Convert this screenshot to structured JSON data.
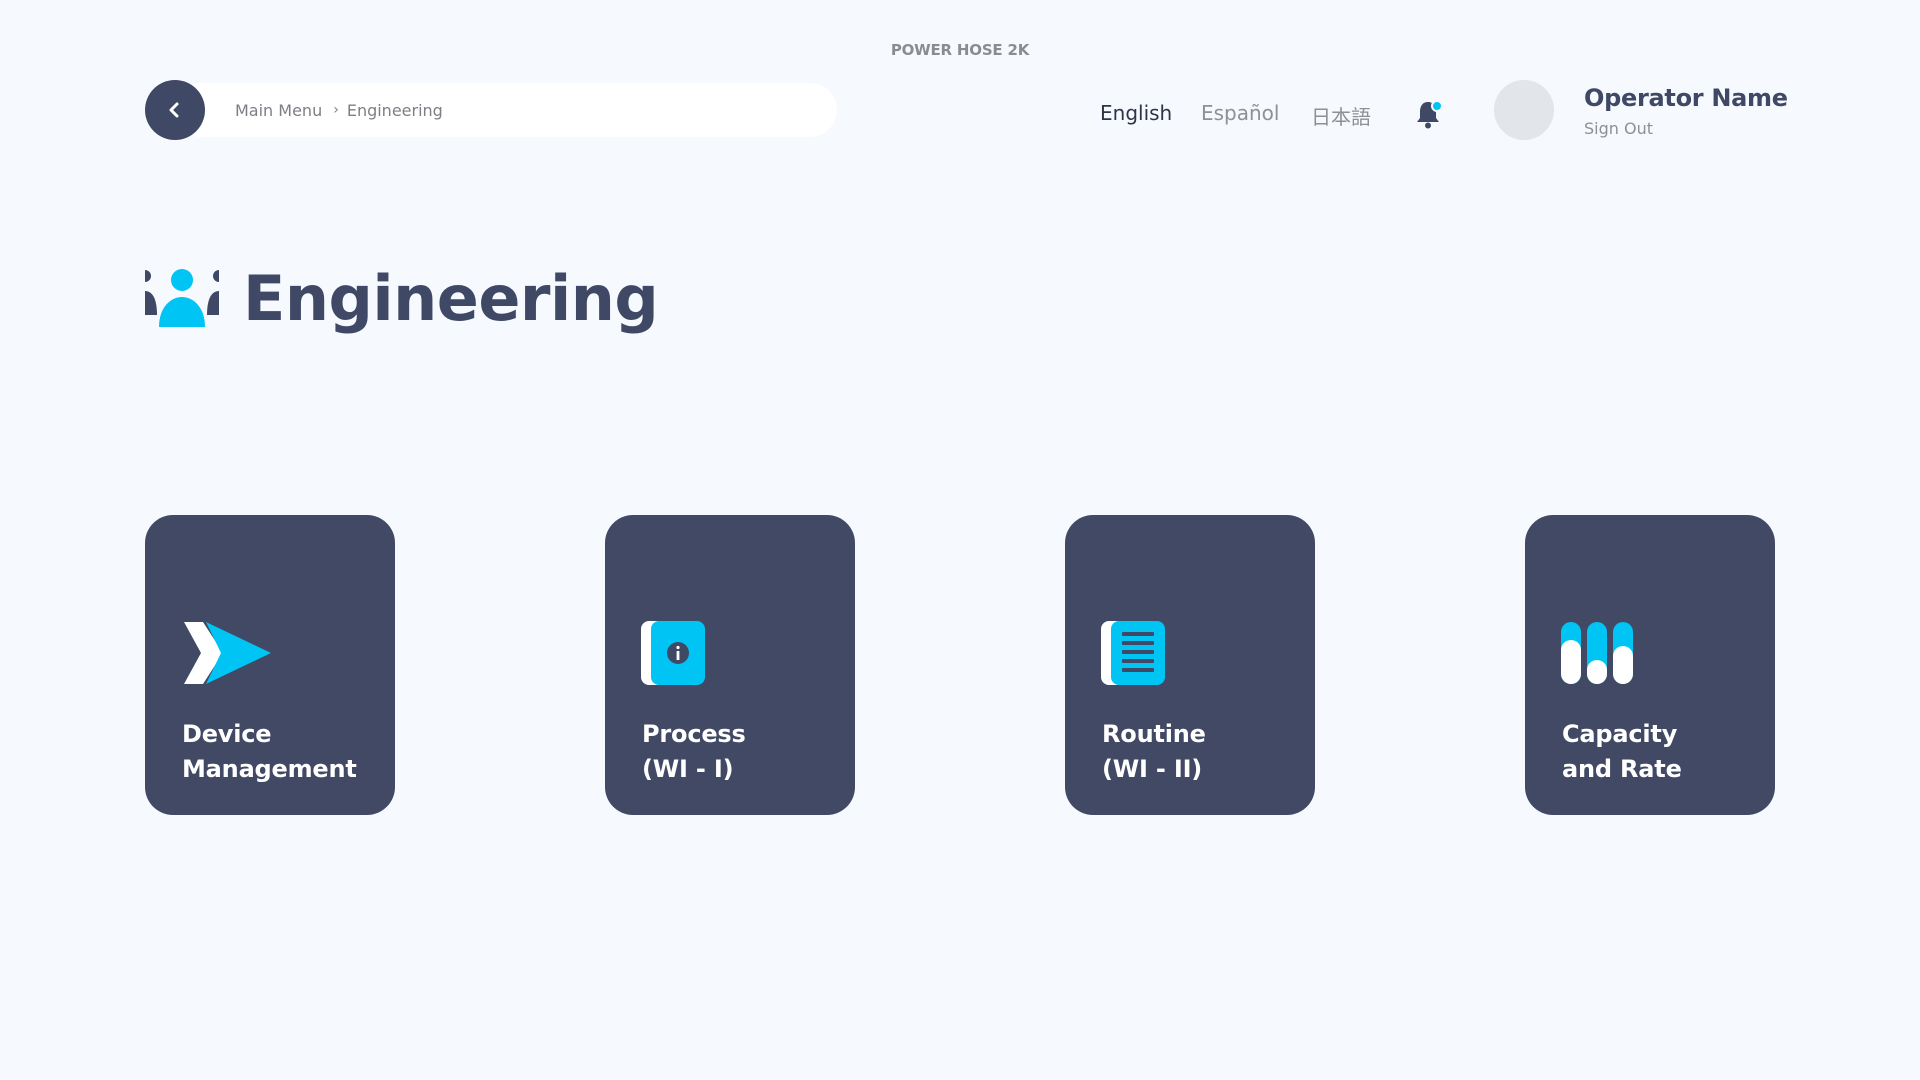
{
  "app": {
    "title": "POWER HOSE 2K"
  },
  "breadcrumb": {
    "items": [
      "Main Menu",
      "Engineering"
    ],
    "separator": "›"
  },
  "languages": [
    {
      "label": "English",
      "active": true
    },
    {
      "label": "Español",
      "active": false
    },
    {
      "label": "日本語",
      "active": false
    }
  ],
  "user": {
    "name": "Operator Name",
    "sign_out": "Sign Out"
  },
  "page": {
    "title": "Engineering",
    "icon": "team-icon"
  },
  "cards": [
    {
      "label": "Device\nManagement",
      "icon": "double-arrow-icon"
    },
    {
      "label": "Process\n(WI - I)",
      "icon": "info-book-icon"
    },
    {
      "label": "Routine\n(WI - II)",
      "icon": "list-book-icon"
    },
    {
      "label": "Capacity\nand Rate",
      "icon": "sliders-icon"
    }
  ],
  "colors": {
    "background": "#f6f9fd",
    "primary": "#414965",
    "accent": "#00c4f4",
    "text_muted": "#8e9096"
  }
}
